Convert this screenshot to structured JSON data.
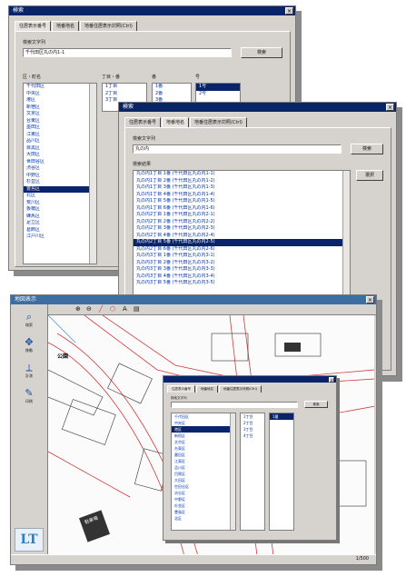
{
  "win1": {
    "title": "検索",
    "tabs": [
      "住居表示番号",
      "地番地名",
      "地番住居表示対照(Ctrl)"
    ],
    "addr_label": "検索文字列",
    "addr_value": "千代田区丸の内1-1",
    "search_btn": "検索",
    "list_headers": [
      "区・町名",
      "丁目・番",
      "番",
      "号"
    ],
    "left_list": [
      "千代田区",
      "中央区",
      "港区",
      "新宿区",
      "文京区",
      "台東区",
      "墨田区",
      "江東区",
      "品川区",
      "目黒区",
      "大田区",
      "世田谷区",
      "渋谷区",
      "中野区",
      "杉並区",
      "豊島区",
      "北区",
      "荒川区",
      "板橋区",
      "練馬区",
      "足立区",
      "葛飾区",
      "江戸川区"
    ],
    "left_selected": 15,
    "mid_list": [
      "1丁目",
      "2丁目",
      "3丁目"
    ],
    "mid2_list": [
      "1番",
      "2番",
      "3番"
    ],
    "right_list": [
      "1号",
      "2号"
    ]
  },
  "win2": {
    "title": "検索",
    "tabs": [
      "住居表示番号",
      "地番地名",
      "地番住居表示対照(Ctrl)"
    ],
    "addr_label": "検索文字列",
    "addr_value": "丸の内",
    "search_btn": "検索",
    "result_label": "検索結果",
    "results": [
      "丸の内1丁目 1番 (千代田区丸の内1-1)",
      "丸の内1丁目 2番 (千代田区丸の内1-2)",
      "丸の内1丁目 3番 (千代田区丸の内1-3)",
      "丸の内1丁目 4番 (千代田区丸の内1-4)",
      "丸の内1丁目 5番 (千代田区丸の内1-5)",
      "丸の内1丁目 6番 (千代田区丸の内1-6)",
      "丸の内2丁目 1番 (千代田区丸の内2-1)",
      "丸の内2丁目 2番 (千代田区丸の内2-2)",
      "丸の内2丁目 3番 (千代田区丸の内2-3)",
      "丸の内2丁目 4番 (千代田区丸の内2-4)",
      "丸の内2丁目 5番 (千代田区丸の内2-5)",
      "丸の内2丁目 6番 (千代田区丸の内2-6)",
      "丸の内3丁目 1番 (千代田区丸の内3-1)",
      "丸の内3丁目 2番 (千代田区丸の内3-2)",
      "丸の内3丁目 3番 (千代田区丸の内3-3)",
      "丸の内3丁目 4番 (千代田区丸の内3-4)",
      "丸の内3丁目 5番 (千代田区丸の内3-5)"
    ],
    "results_selected": 10,
    "select_btn": "選択"
  },
  "win3": {
    "title": "地図表示",
    "tools": [
      {
        "icon": "search-icon",
        "glyph": "⌕",
        "label": "検索"
      },
      {
        "icon": "pan-icon",
        "glyph": "✥",
        "label": "移動"
      },
      {
        "icon": "measure-icon",
        "glyph": "⟂",
        "label": "計測"
      },
      {
        "icon": "print-icon",
        "glyph": "✎",
        "label": "印刷"
      }
    ],
    "map_labels": [
      "駐車場",
      "公園"
    ],
    "status": "1/500",
    "logo": "LT",
    "dialog": {
      "tabs": [
        "住居表示番号",
        "地番地名",
        "地番住居表示対照(Ctrl)"
      ],
      "label": "検索文字列",
      "value": "",
      "btn": "検索",
      "list_a": [
        "千代田区",
        "中央区",
        "港区",
        "新宿区",
        "文京区",
        "台東区",
        "墨田区",
        "江東区",
        "品川区",
        "目黒区",
        "大田区",
        "世田谷区",
        "渋谷区",
        "中野区",
        "杉並区",
        "豊島区",
        "北区"
      ],
      "list_a_selected": 2,
      "list_b": [
        "1丁目",
        "2丁目",
        "3丁目",
        "4丁目"
      ],
      "list_c": [
        "1番"
      ]
    }
  }
}
